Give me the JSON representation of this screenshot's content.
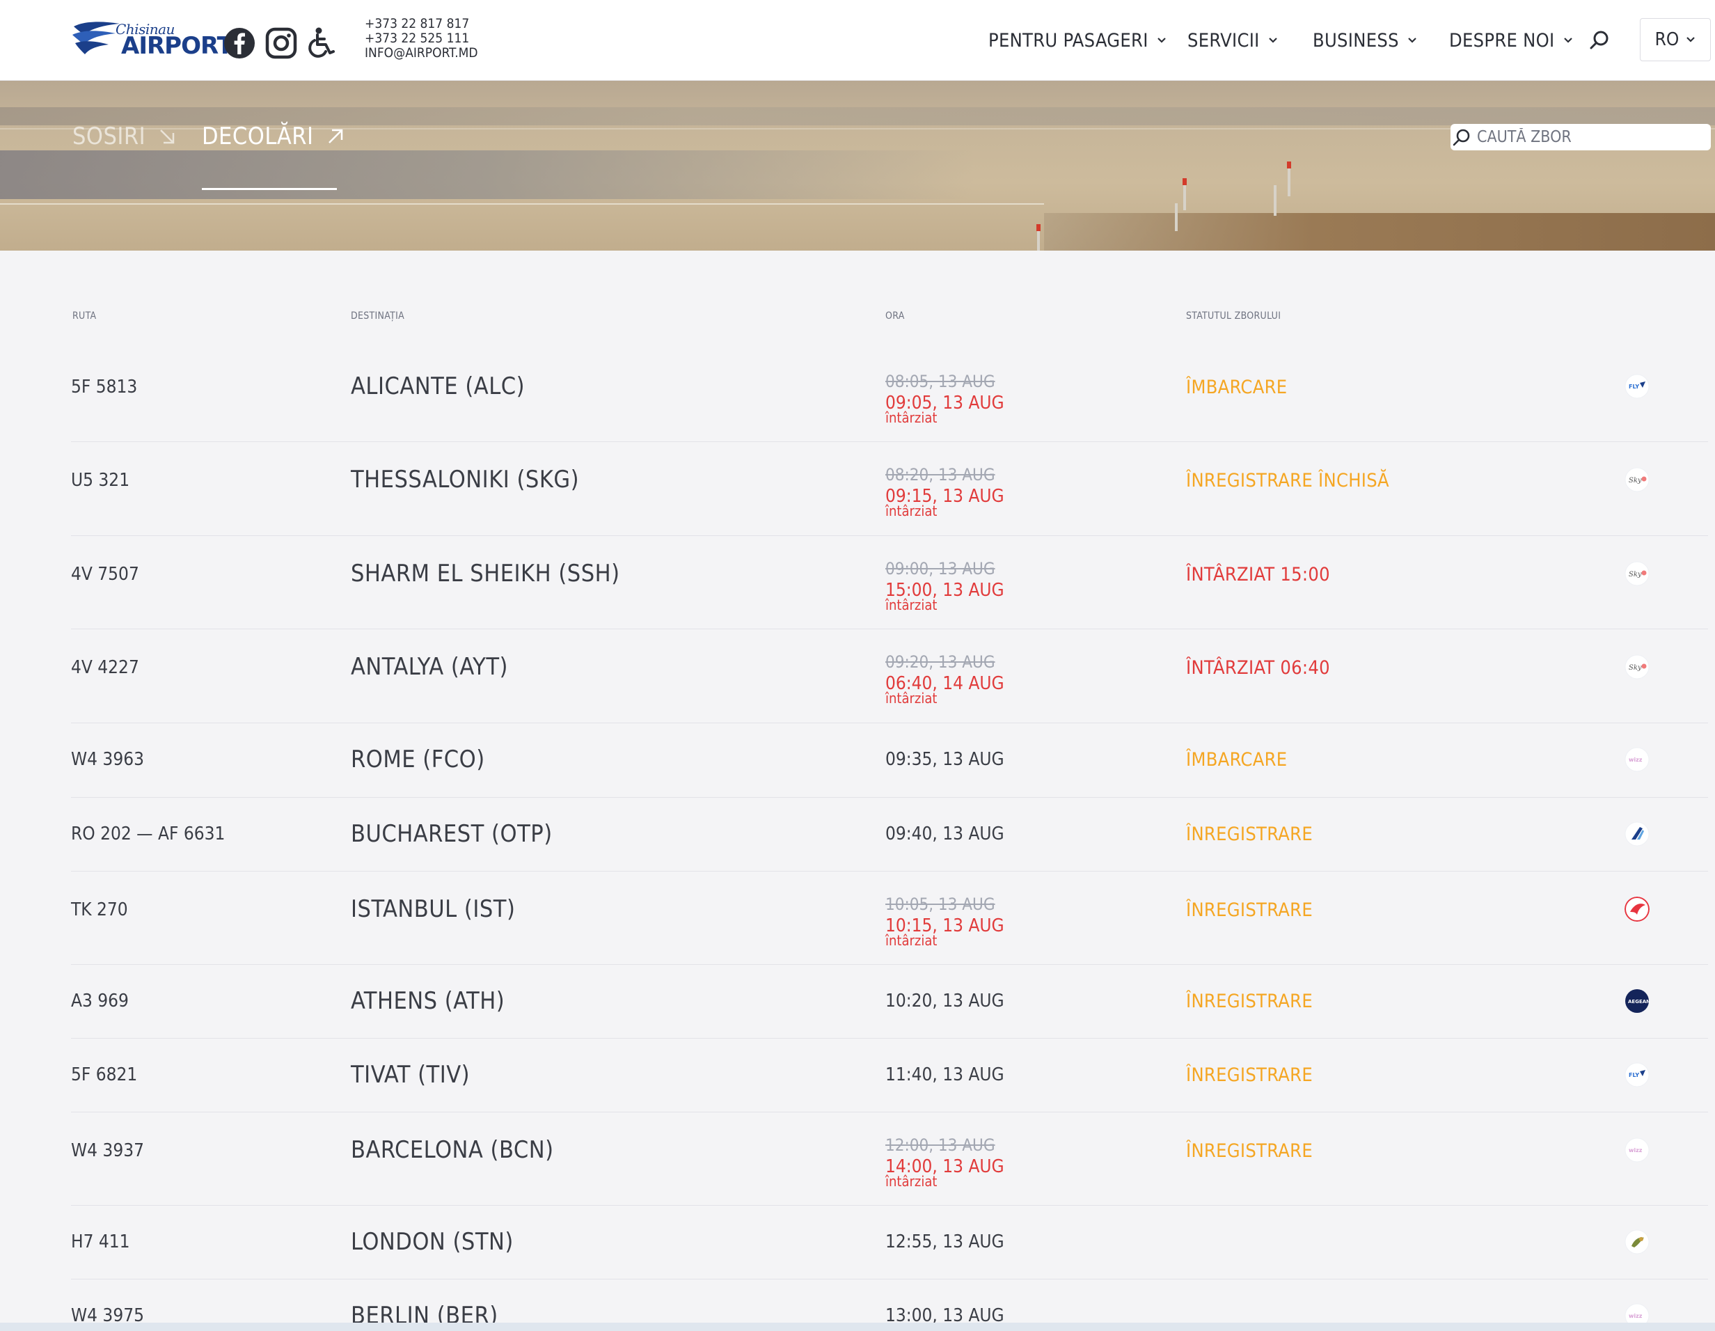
{
  "header": {
    "logo_city": "Chisinau",
    "logo_brand": "AIRPORT",
    "contacts": [
      "+373 22 817 817",
      "+373 22 525 111",
      "INFO@AIRPORT.MD"
    ],
    "nav": [
      {
        "label": "PENTRU PASAGERI"
      },
      {
        "label": "SERVICII"
      },
      {
        "label": "BUSINESS"
      },
      {
        "label": "DESPRE NOI"
      }
    ],
    "language": "RO",
    "icons": [
      "facebook-icon",
      "instagram-icon",
      "accessibility-icon",
      "search-icon",
      "chevron-down-icon"
    ]
  },
  "hero": {
    "tabs": [
      {
        "label": "SOSIRI",
        "active": false
      },
      {
        "label": "DECOLĂRI",
        "active": true
      }
    ],
    "search_placeholder": "CAUTĂ ZBOR"
  },
  "table": {
    "columns": [
      "RUTA",
      "DESTINAȚIA",
      "ORA",
      "STATUTUL ZBORULUI"
    ],
    "rows": [
      {
        "route": "5F 5813",
        "destination": "ALICANTE (ALC)",
        "time_old": "08:05, 13 AUG",
        "time": "09:05, 13 AUG",
        "note": "întârziat",
        "status": "ÎMBARCARE",
        "status_color": "#f5a623",
        "airline": "flyone"
      },
      {
        "route": "U5 321",
        "destination": "THESSALONIKI (SKG)",
        "time_old": "08:20, 13 AUG",
        "time": "09:15, 13 AUG",
        "note": "întârziat",
        "status": "ÎNREGISTRARE ÎNCHISĂ",
        "status_color": "#f5a623",
        "airline": "skyup"
      },
      {
        "route": "4V 7507",
        "destination": "SHARM EL SHEIKH (SSH)",
        "time_old": "09:00, 13 AUG",
        "time": "15:00, 13 AUG",
        "note": "întârziat",
        "status": "ÎNTÂRZIAT 15:00",
        "status_color": "#e13b3b",
        "airline": "skyup"
      },
      {
        "route": "4V 4227",
        "destination": "ANTALYA (AYT)",
        "time_old": "09:20, 13 AUG",
        "time": "06:40, 14 AUG",
        "note": "întârziat",
        "status": "ÎNTÂRZIAT 06:40",
        "status_color": "#e13b3b",
        "airline": "skyup"
      },
      {
        "route": "W4 3963",
        "destination": "ROME (FCO)",
        "time_old": "",
        "time": "09:35, 13 AUG",
        "note": "",
        "status": "ÎMBARCARE",
        "status_color": "#f5a623",
        "airline": "wizzair"
      },
      {
        "route": "RO 202 — AF 6631",
        "destination": "BUCHAREST (OTP)",
        "time_old": "",
        "time": "09:40, 13 AUG",
        "note": "",
        "status": "ÎNREGISTRARE",
        "status_color": "#f5a623",
        "airline": "tarom"
      },
      {
        "route": "TK 270",
        "destination": "ISTANBUL (IST)",
        "time_old": "10:05, 13 AUG",
        "time": "10:15, 13 AUG",
        "note": "întârziat",
        "status": "ÎNREGISTRARE",
        "status_color": "#f5a623",
        "airline": "turkish"
      },
      {
        "route": "A3 969",
        "destination": "ATHENS (ATH)",
        "time_old": "",
        "time": "10:20, 13 AUG",
        "note": "",
        "status": "ÎNREGISTRARE",
        "status_color": "#f5a623",
        "airline": "aegean"
      },
      {
        "route": "5F 6821",
        "destination": "TIVAT (TIV)",
        "time_old": "",
        "time": "11:40, 13 AUG",
        "note": "",
        "status": "ÎNREGISTRARE",
        "status_color": "#f5a623",
        "airline": "flyone"
      },
      {
        "route": "W4 3937",
        "destination": "BARCELONA (BCN)",
        "time_old": "12:00, 13 AUG",
        "time": "14:00, 13 AUG",
        "note": "întârziat",
        "status": "ÎNREGISTRARE",
        "status_color": "#f5a623",
        "airline": "wizzair"
      },
      {
        "route": "H7 411",
        "destination": "LONDON (STN)",
        "time_old": "",
        "time": "12:55, 13 AUG",
        "note": "",
        "status": "",
        "status_color": "#f5a623",
        "airline": "hisky"
      },
      {
        "route": "W4 3975",
        "destination": "BERLIN (BER)",
        "time_old": "",
        "time": "13:00, 13 AUG",
        "note": "",
        "status": "",
        "status_color": "#f5a623",
        "airline": "wizzair"
      }
    ]
  },
  "colors": {
    "brand_blue": "#1b3f8a",
    "status_orange": "#f5a623",
    "status_red": "#e13b3b",
    "background": "#f4f4f6"
  }
}
